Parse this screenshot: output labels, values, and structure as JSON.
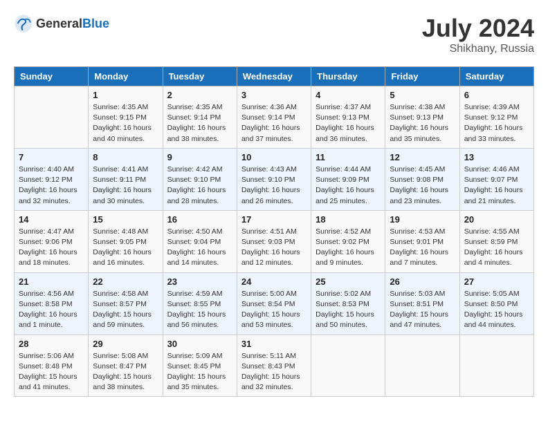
{
  "header": {
    "logo_general": "General",
    "logo_blue": "Blue",
    "title": "July 2024",
    "location": "Shikhany, Russia"
  },
  "weekdays": [
    "Sunday",
    "Monday",
    "Tuesday",
    "Wednesday",
    "Thursday",
    "Friday",
    "Saturday"
  ],
  "weeks": [
    [
      {
        "day": "",
        "info": ""
      },
      {
        "day": "1",
        "info": "Sunrise: 4:35 AM\nSunset: 9:15 PM\nDaylight: 16 hours\nand 40 minutes."
      },
      {
        "day": "2",
        "info": "Sunrise: 4:35 AM\nSunset: 9:14 PM\nDaylight: 16 hours\nand 38 minutes."
      },
      {
        "day": "3",
        "info": "Sunrise: 4:36 AM\nSunset: 9:14 PM\nDaylight: 16 hours\nand 37 minutes."
      },
      {
        "day": "4",
        "info": "Sunrise: 4:37 AM\nSunset: 9:13 PM\nDaylight: 16 hours\nand 36 minutes."
      },
      {
        "day": "5",
        "info": "Sunrise: 4:38 AM\nSunset: 9:13 PM\nDaylight: 16 hours\nand 35 minutes."
      },
      {
        "day": "6",
        "info": "Sunrise: 4:39 AM\nSunset: 9:12 PM\nDaylight: 16 hours\nand 33 minutes."
      }
    ],
    [
      {
        "day": "7",
        "info": "Sunrise: 4:40 AM\nSunset: 9:12 PM\nDaylight: 16 hours\nand 32 minutes."
      },
      {
        "day": "8",
        "info": "Sunrise: 4:41 AM\nSunset: 9:11 PM\nDaylight: 16 hours\nand 30 minutes."
      },
      {
        "day": "9",
        "info": "Sunrise: 4:42 AM\nSunset: 9:10 PM\nDaylight: 16 hours\nand 28 minutes."
      },
      {
        "day": "10",
        "info": "Sunrise: 4:43 AM\nSunset: 9:10 PM\nDaylight: 16 hours\nand 26 minutes."
      },
      {
        "day": "11",
        "info": "Sunrise: 4:44 AM\nSunset: 9:09 PM\nDaylight: 16 hours\nand 25 minutes."
      },
      {
        "day": "12",
        "info": "Sunrise: 4:45 AM\nSunset: 9:08 PM\nDaylight: 16 hours\nand 23 minutes."
      },
      {
        "day": "13",
        "info": "Sunrise: 4:46 AM\nSunset: 9:07 PM\nDaylight: 16 hours\nand 21 minutes."
      }
    ],
    [
      {
        "day": "14",
        "info": "Sunrise: 4:47 AM\nSunset: 9:06 PM\nDaylight: 16 hours\nand 18 minutes."
      },
      {
        "day": "15",
        "info": "Sunrise: 4:48 AM\nSunset: 9:05 PM\nDaylight: 16 hours\nand 16 minutes."
      },
      {
        "day": "16",
        "info": "Sunrise: 4:50 AM\nSunset: 9:04 PM\nDaylight: 16 hours\nand 14 minutes."
      },
      {
        "day": "17",
        "info": "Sunrise: 4:51 AM\nSunset: 9:03 PM\nDaylight: 16 hours\nand 12 minutes."
      },
      {
        "day": "18",
        "info": "Sunrise: 4:52 AM\nSunset: 9:02 PM\nDaylight: 16 hours\nand 9 minutes."
      },
      {
        "day": "19",
        "info": "Sunrise: 4:53 AM\nSunset: 9:01 PM\nDaylight: 16 hours\nand 7 minutes."
      },
      {
        "day": "20",
        "info": "Sunrise: 4:55 AM\nSunset: 8:59 PM\nDaylight: 16 hours\nand 4 minutes."
      }
    ],
    [
      {
        "day": "21",
        "info": "Sunrise: 4:56 AM\nSunset: 8:58 PM\nDaylight: 16 hours\nand 1 minute."
      },
      {
        "day": "22",
        "info": "Sunrise: 4:58 AM\nSunset: 8:57 PM\nDaylight: 15 hours\nand 59 minutes."
      },
      {
        "day": "23",
        "info": "Sunrise: 4:59 AM\nSunset: 8:55 PM\nDaylight: 15 hours\nand 56 minutes."
      },
      {
        "day": "24",
        "info": "Sunrise: 5:00 AM\nSunset: 8:54 PM\nDaylight: 15 hours\nand 53 minutes."
      },
      {
        "day": "25",
        "info": "Sunrise: 5:02 AM\nSunset: 8:53 PM\nDaylight: 15 hours\nand 50 minutes."
      },
      {
        "day": "26",
        "info": "Sunrise: 5:03 AM\nSunset: 8:51 PM\nDaylight: 15 hours\nand 47 minutes."
      },
      {
        "day": "27",
        "info": "Sunrise: 5:05 AM\nSunset: 8:50 PM\nDaylight: 15 hours\nand 44 minutes."
      }
    ],
    [
      {
        "day": "28",
        "info": "Sunrise: 5:06 AM\nSunset: 8:48 PM\nDaylight: 15 hours\nand 41 minutes."
      },
      {
        "day": "29",
        "info": "Sunrise: 5:08 AM\nSunset: 8:47 PM\nDaylight: 15 hours\nand 38 minutes."
      },
      {
        "day": "30",
        "info": "Sunrise: 5:09 AM\nSunset: 8:45 PM\nDaylight: 15 hours\nand 35 minutes."
      },
      {
        "day": "31",
        "info": "Sunrise: 5:11 AM\nSunset: 8:43 PM\nDaylight: 15 hours\nand 32 minutes."
      },
      {
        "day": "",
        "info": ""
      },
      {
        "day": "",
        "info": ""
      },
      {
        "day": "",
        "info": ""
      }
    ]
  ]
}
